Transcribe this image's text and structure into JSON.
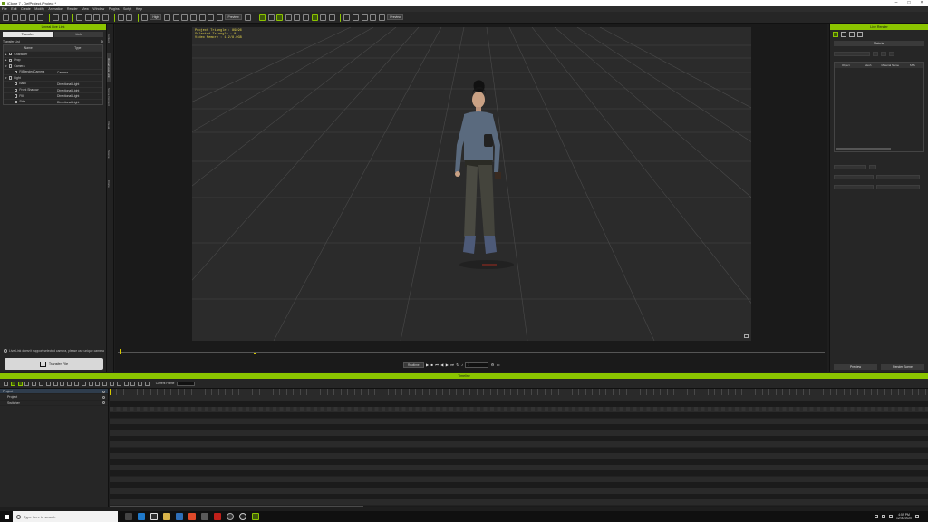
{
  "window": {
    "title": "iClone 7 - DefProject.iProject *"
  },
  "menu": [
    "File",
    "Edit",
    "Create",
    "Modify",
    "Animation",
    "Render",
    "View",
    "Window",
    "Plugins",
    "Script",
    "Help"
  ],
  "toolbar": {
    "quality": "High",
    "preview": "Preview",
    "preview2": "Preview"
  },
  "left_panel": {
    "title": "Unreal Live Link",
    "tabs": [
      "Transfer",
      "Link"
    ],
    "transfer_list_label": "Transfer List",
    "columns": [
      "Name",
      "Type"
    ],
    "rows": [
      {
        "name": "Character",
        "type": "",
        "indent": 0,
        "expand": "▸"
      },
      {
        "name": "Prop",
        "type": "",
        "indent": 0,
        "expand": "▸"
      },
      {
        "name": "Camera",
        "type": "",
        "indent": 0,
        "expand": "▾"
      },
      {
        "name": "RiBlendedCamera",
        "type": "Camera",
        "indent": 1,
        "expand": ""
      },
      {
        "name": "Light",
        "type": "",
        "indent": 0,
        "expand": "▾"
      },
      {
        "name": "Back",
        "type": "Directional Light",
        "indent": 1,
        "expand": ""
      },
      {
        "name": "Front Shadow",
        "type": "Directional Light",
        "indent": 1,
        "expand": ""
      },
      {
        "name": "Fill",
        "type": "Directional Light",
        "indent": 1,
        "expand": ""
      },
      {
        "name": "Side",
        "type": "Directional Light",
        "indent": 1,
        "expand": ""
      }
    ],
    "note": "Live Link doesn't support selected camera, please use unique camera",
    "transfer_button": "Transfer File"
  },
  "side_tabs": [
    "Content",
    "Unreal Live Link",
    "Scene Content",
    "Visual",
    "Scene",
    "Clone"
  ],
  "viewport": {
    "stats": "Project Triangle : 89896\nSelected Triangle : 0\nVideo Memory : 1.2/8.0GB"
  },
  "playbar": {
    "realtime": "Realtime",
    "frame": "1"
  },
  "right_panel": {
    "title": "Live Render",
    "sub": "Material",
    "columns": [
      "Object",
      "Mesh",
      "Material Name",
      "SSS"
    ],
    "bottom_buttons": [
      "Preview",
      "Render Scene"
    ]
  },
  "timeline": {
    "title": "Timeline",
    "current_frame_label": "Current Frame",
    "tracks": [
      "Project",
      "Project",
      "Switcher"
    ]
  },
  "taskbar": {
    "search_placeholder": "Type here to search",
    "time": "4:59 PM",
    "date": "12/30/2020"
  }
}
